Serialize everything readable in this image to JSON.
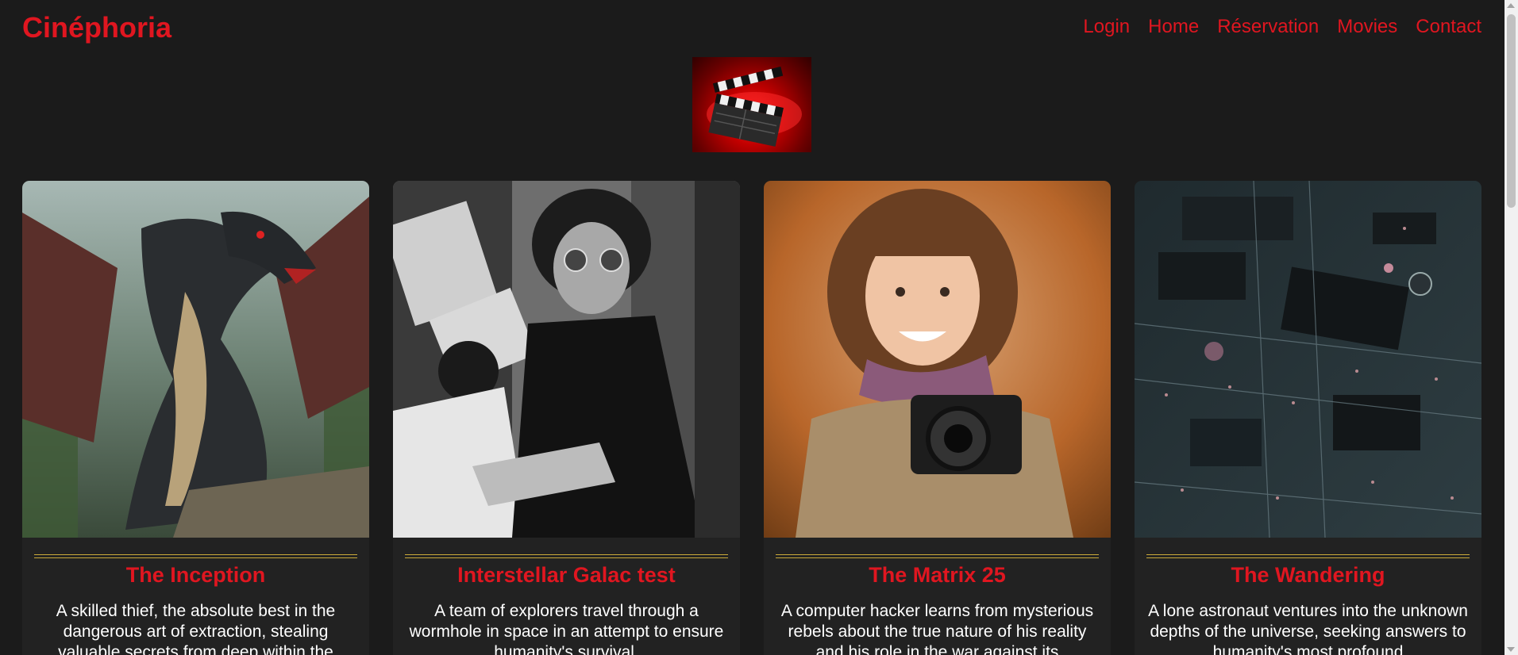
{
  "header": {
    "brand": "Cinéphoria",
    "nav": [
      "Login",
      "Home",
      "Réservation",
      "Movies",
      "Contact"
    ]
  },
  "logo": {
    "icon": "clapperboard-icon"
  },
  "movies": [
    {
      "title": "The Inception",
      "description": "A skilled thief, the absolute best in the dangerous art of extraction, stealing valuable secrets from deep within the",
      "poster": "dragon-image"
    },
    {
      "title": "Interstellar Galac test",
      "description": "A team of explorers travel through a wormhole in space in an attempt to ensure humanity's survival.",
      "poster": "bw-portrait-image"
    },
    {
      "title": "The Matrix 25",
      "description": "A computer hacker learns from mysterious rebels about the true nature of his reality and his role in the war against its",
      "poster": "girl-camera-image"
    },
    {
      "title": "The Wandering",
      "description": "A lone astronaut ventures into the unknown depths of the universe, seeking answers to humanity's most profound",
      "poster": "circuit-board-image"
    }
  ],
  "colors": {
    "background": "#1b1b1b",
    "accent": "#e01620",
    "card": "#222222",
    "rule": "#c9a93a"
  }
}
